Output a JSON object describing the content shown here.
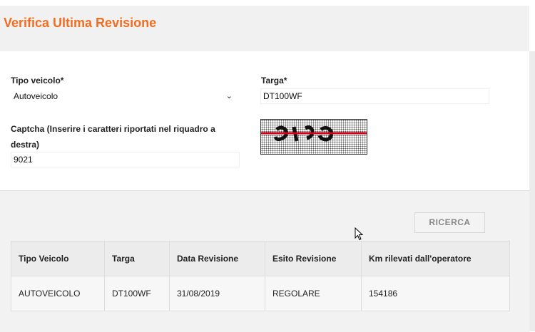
{
  "page": {
    "title": "Verifica Ultima Revisione"
  },
  "form": {
    "vehicle_type_label": "Tipo veicolo*",
    "vehicle_type_value": "Autoveicolo",
    "plate_label": "Targa*",
    "plate_value": "DT100WF",
    "captcha_label": "Captcha (Inserire i caratteri riportati nel riquadro a destra)",
    "captcha_value": "9021"
  },
  "search_button": "RICERCA",
  "table": {
    "headers": [
      "Tipo Veicolo",
      "Targa",
      "Data Revisione",
      "Esito Revisione",
      "Km rilevati dall'operatore"
    ],
    "rows": [
      [
        "AUTOVEICOLO",
        "DT100WF",
        "31/08/2019",
        "REGOLARE",
        "154186"
      ]
    ]
  }
}
